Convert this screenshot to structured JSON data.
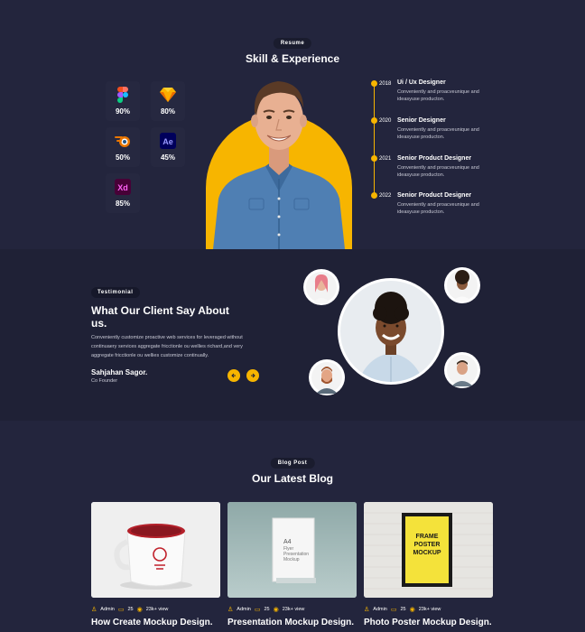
{
  "resume": {
    "pill": "Resume",
    "title": "Skill & Experience",
    "skills": [
      {
        "icon": "figma-icon",
        "pct": "90%"
      },
      {
        "icon": "sketch-icon",
        "pct": "80%"
      },
      {
        "icon": "blender-icon",
        "pct": "50%"
      },
      {
        "icon": "after-effects-icon",
        "pct": "45%"
      },
      {
        "icon": "adobe-xd-icon",
        "pct": "85%"
      }
    ],
    "timeline": [
      {
        "year": "2018",
        "title": "Ui / Ux Designer",
        "desc": "Conveniently and proacveunique and ideasyuse producton."
      },
      {
        "year": "2020",
        "title": "Senior Designer",
        "desc": "Conveniently and proacveunique and ideasyuse producton."
      },
      {
        "year": "2021",
        "title": "Senior Product Designer",
        "desc": "Conveniently and proacveunique and ideasyuse producton."
      },
      {
        "year": "2022",
        "title": "Senior Product Designer",
        "desc": "Conveniently and proacveunique and ideasyuse producton."
      }
    ]
  },
  "testimonial": {
    "pill": "Testimonial",
    "title": "What Our Client Say About us.",
    "desc": "Conveniently customize proactive web services for leveraged without continuaery services aggregate fricctionle ou wellies richard,and very aggregate fricctionle ou wellies customize continually.",
    "name": "Sahjahan Sagor.",
    "role": "Co Founder"
  },
  "blog": {
    "pill": "Blog Post",
    "title": "Our Latest Blog",
    "posts": [
      {
        "author": "Admin",
        "comments": "25",
        "views": "23k+ view",
        "title": "How Create Mockup Design."
      },
      {
        "author": "Admin",
        "comments": "25",
        "views": "23k+ view",
        "title": "Presentation Mockup Design."
      },
      {
        "author": "Admin",
        "comments": "25",
        "views": "23k+ view",
        "title": "Photo Poster Mockup Design."
      }
    ],
    "mockup_texts": {
      "book_line1": "A4",
      "book_line2": "Flyer",
      "book_line3": "Presentation",
      "book_line4": "Mockup",
      "poster_line1": "FRAME",
      "poster_line2": "POSTER",
      "poster_line3": "MOCKUP"
    }
  },
  "colors": {
    "accent": "#f7b500",
    "bg": "#23253d",
    "bg_alt": "#1f2136"
  }
}
